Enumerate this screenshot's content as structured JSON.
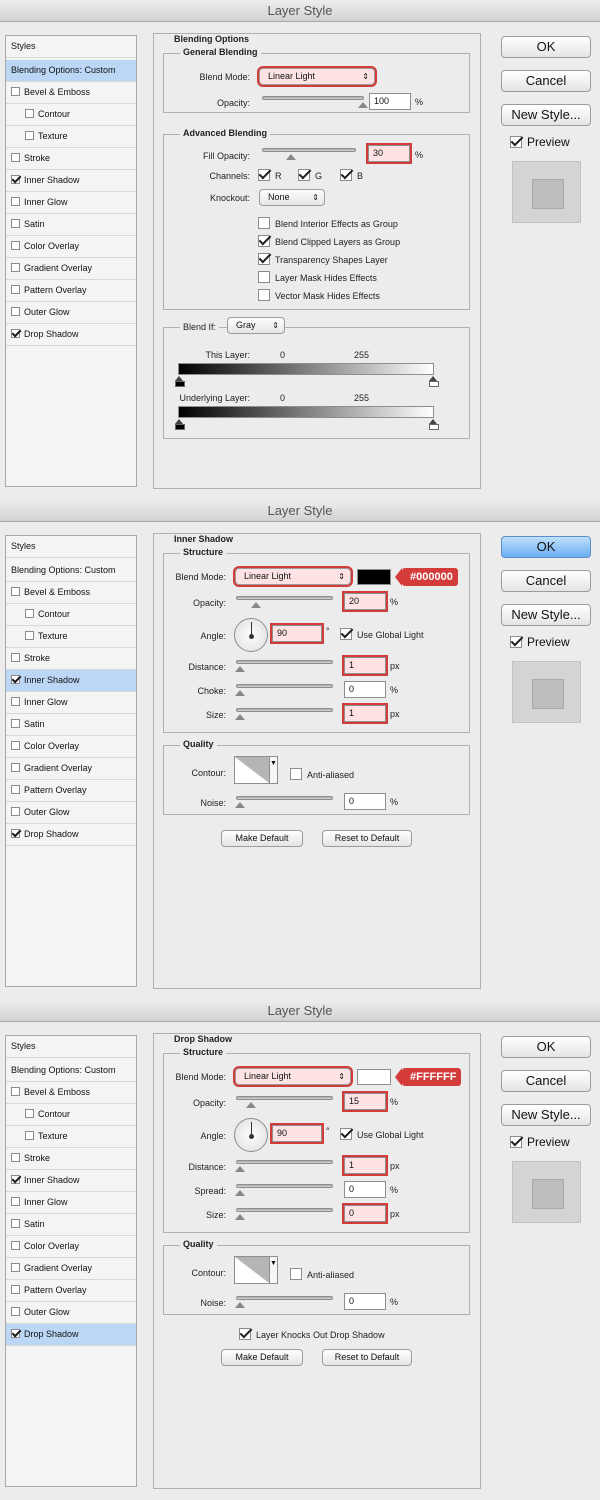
{
  "dialog_title": "Layer Style",
  "buttons": {
    "ok": "OK",
    "cancel": "Cancel",
    "new_style": "New Style...",
    "preview": "Preview",
    "make_default": "Make Default",
    "reset_default": "Reset to Default"
  },
  "sidebar": {
    "header": "Styles",
    "blending": "Blending Options: Custom",
    "items": [
      {
        "label": "Bevel & Emboss"
      },
      {
        "label": "Contour"
      },
      {
        "label": "Texture"
      },
      {
        "label": "Stroke"
      },
      {
        "label": "Inner Shadow"
      },
      {
        "label": "Inner Glow"
      },
      {
        "label": "Satin"
      },
      {
        "label": "Color Overlay"
      },
      {
        "label": "Gradient Overlay"
      },
      {
        "label": "Pattern Overlay"
      },
      {
        "label": "Outer Glow"
      },
      {
        "label": "Drop Shadow"
      }
    ]
  },
  "panel1": {
    "title": "Blending Options",
    "general": "General Blending",
    "blend_mode_label": "Blend Mode:",
    "blend_mode": "Linear Light",
    "opacity_label": "Opacity:",
    "opacity": "100",
    "opacity_level": 1.0,
    "advanced": "Advanced Blending",
    "fill_opacity_label": "Fill Opacity:",
    "fill_opacity": "30",
    "fill_level": 0.3,
    "channels_label": "Channels:",
    "ch_r": "R",
    "ch_g": "G",
    "ch_b": "B",
    "knockout_label": "Knockout:",
    "knockout": "None",
    "opts": [
      "Blend Interior Effects as Group",
      "Blend Clipped Layers as Group",
      "Transparency Shapes Layer",
      "Layer Mask Hides Effects",
      "Vector Mask Hides Effects"
    ],
    "blend_if_label": "Blend If:",
    "blend_if": "Gray",
    "this_layer": "This Layer:",
    "underlying": "Underlying Layer:",
    "min": "0",
    "max": "255"
  },
  "panel2": {
    "title": "Inner Shadow",
    "structure": "Structure",
    "blend_mode_label": "Blend Mode:",
    "blend_mode": "Linear Light",
    "color": "#000000",
    "color_tag": "#000000",
    "opacity_label": "Opacity:",
    "opacity": "20",
    "opacity_level": 0.2,
    "angle_label": "Angle:",
    "angle": "90",
    "global_light": "Use Global Light",
    "distance_label": "Distance:",
    "distance": "1",
    "choke_label": "Choke:",
    "choke": "0",
    "size_label": "Size:",
    "size": "1",
    "px": "px",
    "pct": "%",
    "deg": "°",
    "quality": "Quality",
    "contour_label": "Contour:",
    "anti_aliased": "Anti-aliased",
    "noise_label": "Noise:",
    "noise": "0"
  },
  "panel3": {
    "title": "Drop Shadow",
    "structure": "Structure",
    "blend_mode_label": "Blend Mode:",
    "blend_mode": "Linear Light",
    "color": "#FFFFFF",
    "color_tag": "#FFFFFF",
    "opacity_label": "Opacity:",
    "opacity": "15",
    "opacity_level": 0.15,
    "angle_label": "Angle:",
    "angle": "90",
    "global_light": "Use Global Light",
    "distance_label": "Distance:",
    "distance": "1",
    "spread_label": "Spread:",
    "spread": "0",
    "size_label": "Size:",
    "size": "0",
    "px": "px",
    "pct": "%",
    "deg": "°",
    "quality": "Quality",
    "contour_label": "Contour:",
    "anti_aliased": "Anti-aliased",
    "noise_label": "Noise:",
    "noise": "0",
    "knocks_out": "Layer Knocks Out Drop Shadow"
  }
}
